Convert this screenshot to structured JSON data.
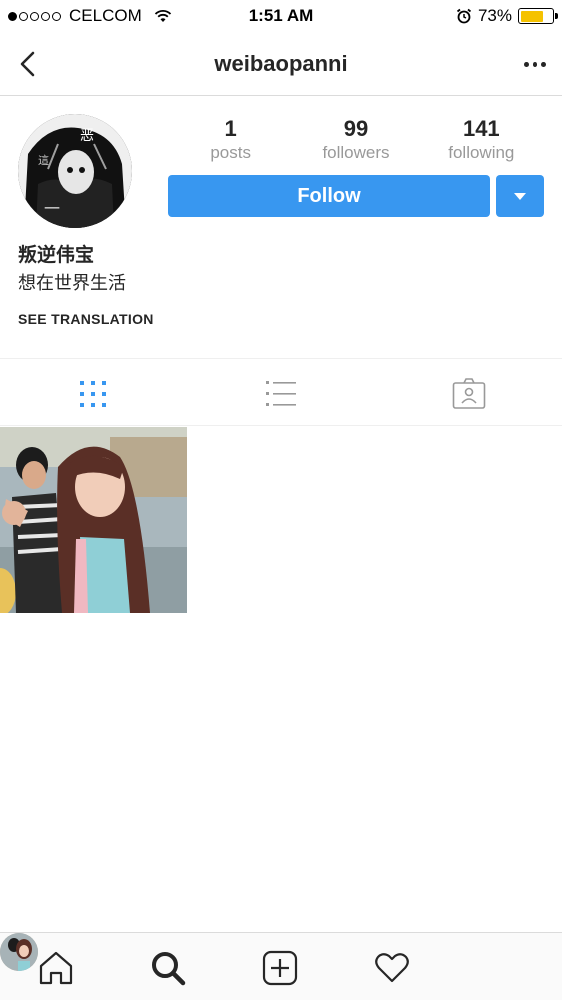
{
  "status_bar": {
    "carrier": "CELCOM",
    "time": "1:51 AM",
    "battery": "73%",
    "battery_level": 0.73,
    "signal_bars_filled": 1,
    "signal_bars_total": 5,
    "battery_color": "#f5c200"
  },
  "header": {
    "title": "weibaopanni",
    "back_icon": "chevron-left-icon",
    "more_icon": "more-horizontal-icon"
  },
  "profile": {
    "stats": [
      {
        "value": "1",
        "label": "posts"
      },
      {
        "value": "99",
        "label": "followers"
      },
      {
        "value": "141",
        "label": "following"
      }
    ],
    "follow_label": "Follow",
    "accent_color": "#3897f0",
    "name": "叛逆伟宝",
    "bio": "想在世界生活",
    "see_translation": "SEE TRANSLATION"
  },
  "tabs": [
    {
      "icon": "grid-icon",
      "active": true
    },
    {
      "icon": "list-icon",
      "active": false
    },
    {
      "icon": "tagged-icon",
      "active": false
    }
  ],
  "bottom_nav": [
    {
      "icon": "home-icon"
    },
    {
      "icon": "search-icon"
    },
    {
      "icon": "add-post-icon"
    },
    {
      "icon": "heart-icon"
    },
    {
      "icon": "profile-avatar"
    }
  ]
}
